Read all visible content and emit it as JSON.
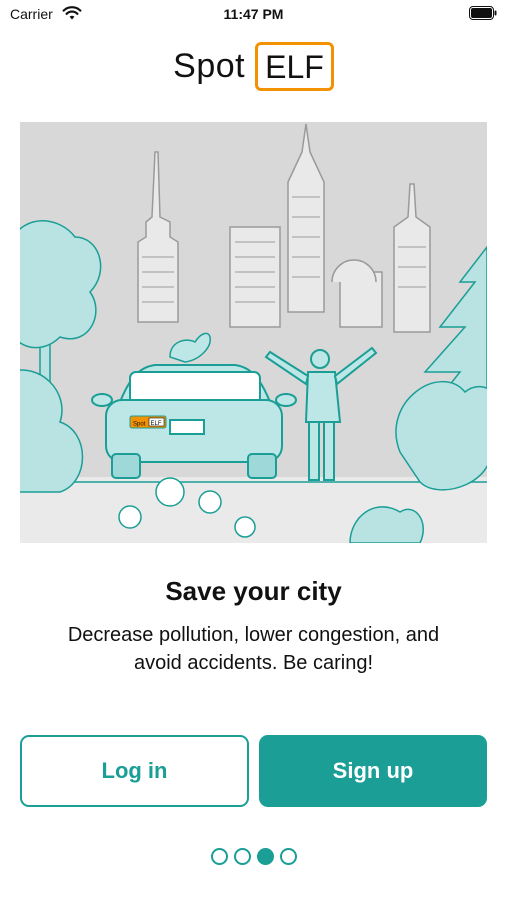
{
  "status_bar": {
    "carrier": "Carrier",
    "time": "11:47 PM",
    "wifi_icon": "wifi-icon",
    "battery_icon": "battery-icon"
  },
  "logo": {
    "word": "Spot",
    "boxed_word": "ELF",
    "accent_color": "#f39200"
  },
  "illustration": {
    "bumper_logo_word": "Spot",
    "bumper_logo_boxed": "ELF"
  },
  "onboarding": {
    "title": "Save your city",
    "description": "Decrease pollution, lower congestion, and avoid accidents. Be caring!"
  },
  "buttons": {
    "login_label": "Log in",
    "signup_label": "Sign up",
    "primary_color": "#1a9e96"
  },
  "pager": {
    "pages": 4,
    "active_index": 2
  }
}
